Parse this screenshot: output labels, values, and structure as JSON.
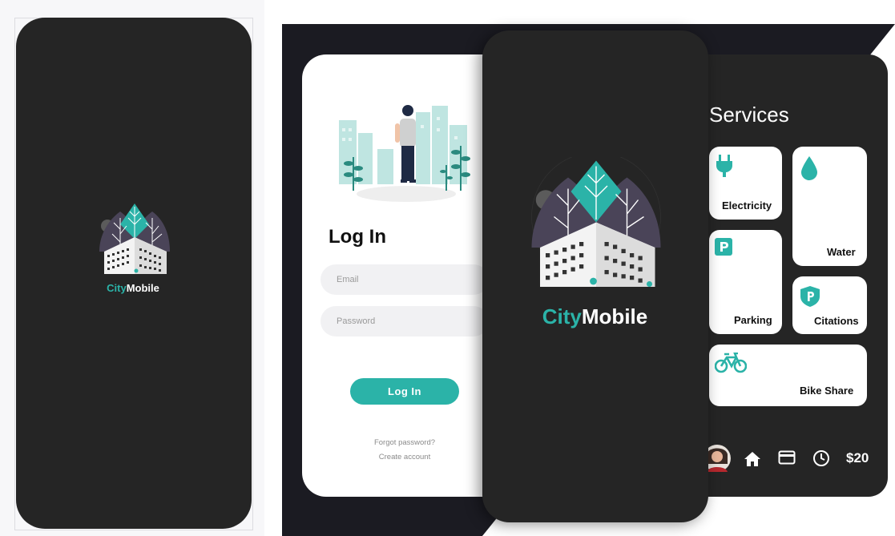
{
  "splash": {
    "brand_prefix": "City",
    "brand_suffix": "Mobile"
  },
  "login": {
    "title": "Log In",
    "email_placeholder": "Email",
    "password_placeholder": "Password",
    "button_label": "Log In",
    "forgot_password": "Forgot password?",
    "create_account": "Create account"
  },
  "services": {
    "title": "Services",
    "tiles": [
      {
        "label": "Electricity",
        "icon": "plug-icon"
      },
      {
        "label": "Water",
        "icon": "water-drop-icon"
      },
      {
        "label": "Parking",
        "icon": "parking-icon"
      },
      {
        "label": "Citations",
        "icon": "badge-p-icon"
      },
      {
        "label": "Bike Share",
        "icon": "bicycle-icon"
      }
    ]
  },
  "bottom_nav": {
    "items": [
      "avatar",
      "home-icon",
      "card-icon",
      "clock-icon"
    ],
    "balance": "$20"
  },
  "colors": {
    "accent": "#2bb3a8",
    "dark_panel": "#252525",
    "background": "#1b1b22"
  }
}
